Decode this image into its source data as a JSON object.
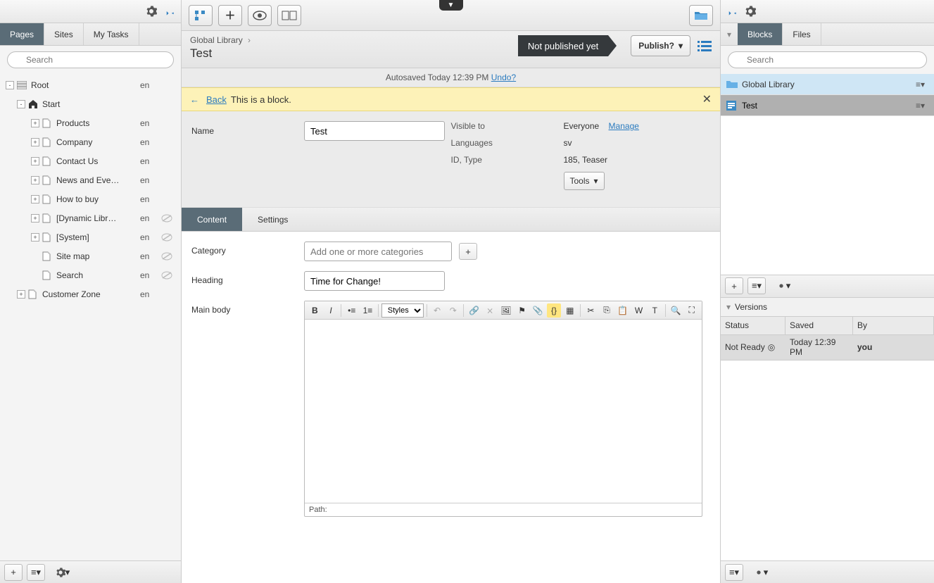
{
  "left": {
    "search_placeholder": "Search",
    "tabs": [
      {
        "label": "Pages",
        "active": true
      },
      {
        "label": "Sites",
        "active": false
      },
      {
        "label": "My Tasks",
        "active": false
      }
    ],
    "tree": [
      {
        "indent": 0,
        "expander": "-",
        "icon": "root",
        "label": "Root",
        "lang": "en",
        "eye": false
      },
      {
        "indent": 1,
        "expander": "-",
        "icon": "home",
        "label": "Start",
        "lang": "",
        "eye": false
      },
      {
        "indent": 2,
        "expander": "+",
        "icon": "page",
        "label": "Products",
        "lang": "en",
        "eye": false
      },
      {
        "indent": 2,
        "expander": "+",
        "icon": "page",
        "label": "Company",
        "lang": "en",
        "eye": false
      },
      {
        "indent": 2,
        "expander": "+",
        "icon": "page",
        "label": "Contact Us",
        "lang": "en",
        "eye": false
      },
      {
        "indent": 2,
        "expander": "+",
        "icon": "page",
        "label": "News and Eve…",
        "lang": "en",
        "eye": false
      },
      {
        "indent": 2,
        "expander": "+",
        "icon": "page",
        "label": "How to buy",
        "lang": "en",
        "eye": false
      },
      {
        "indent": 2,
        "expander": "+",
        "icon": "page",
        "label": "[Dynamic Libr…",
        "lang": "en",
        "eye": true
      },
      {
        "indent": 2,
        "expander": "+",
        "icon": "page",
        "label": "[System]",
        "lang": "en",
        "eye": true
      },
      {
        "indent": 2,
        "expander": "",
        "icon": "page",
        "label": "Site map",
        "lang": "en",
        "eye": true
      },
      {
        "indent": 2,
        "expander": "",
        "icon": "page",
        "label": "Search",
        "lang": "en",
        "eye": true
      },
      {
        "indent": 1,
        "expander": "+",
        "icon": "page",
        "label": "Customer Zone",
        "lang": "en",
        "eye": false
      }
    ]
  },
  "center": {
    "breadcrumb": {
      "path": "Global Library",
      "title": "Test"
    },
    "status": "Not published yet",
    "publish_label": "Publish?",
    "autosave": {
      "text": "Autosaved Today 12:39 PM",
      "undo": "Undo?"
    },
    "banner": {
      "back": "Back",
      "msg": "This is a block."
    },
    "form": {
      "name_label": "Name",
      "name_value": "Test",
      "visible_label": "Visible to",
      "visible_value": "Everyone",
      "manage": "Manage",
      "languages_label": "Languages",
      "languages_value": "sv",
      "idtype_label": "ID, Type",
      "idtype_value": "185, Teaser",
      "tools": "Tools"
    },
    "ctabs": [
      {
        "label": "Content",
        "active": true
      },
      {
        "label": "Settings",
        "active": false
      }
    ],
    "content": {
      "category_label": "Category",
      "category_placeholder": "Add one or more categories",
      "heading_label": "Heading",
      "heading_value": "Time for Change!",
      "mainbody_label": "Main body",
      "styles_label": "Styles",
      "path_label": "Path:"
    }
  },
  "right": {
    "search_placeholder": "Search",
    "tabs": [
      {
        "label": "Blocks",
        "active": true
      },
      {
        "label": "Files",
        "active": false
      }
    ],
    "rows": [
      {
        "type": "folder",
        "label": "Global Library"
      },
      {
        "type": "block",
        "label": "Test",
        "selected": true
      }
    ],
    "versions_title": "Versions",
    "versions_cols": {
      "c1": "Status",
      "c2": "Saved",
      "c3": "By"
    },
    "version_row": {
      "status": "Not Ready",
      "saved": "Today 12:39 PM",
      "by": "you"
    }
  }
}
